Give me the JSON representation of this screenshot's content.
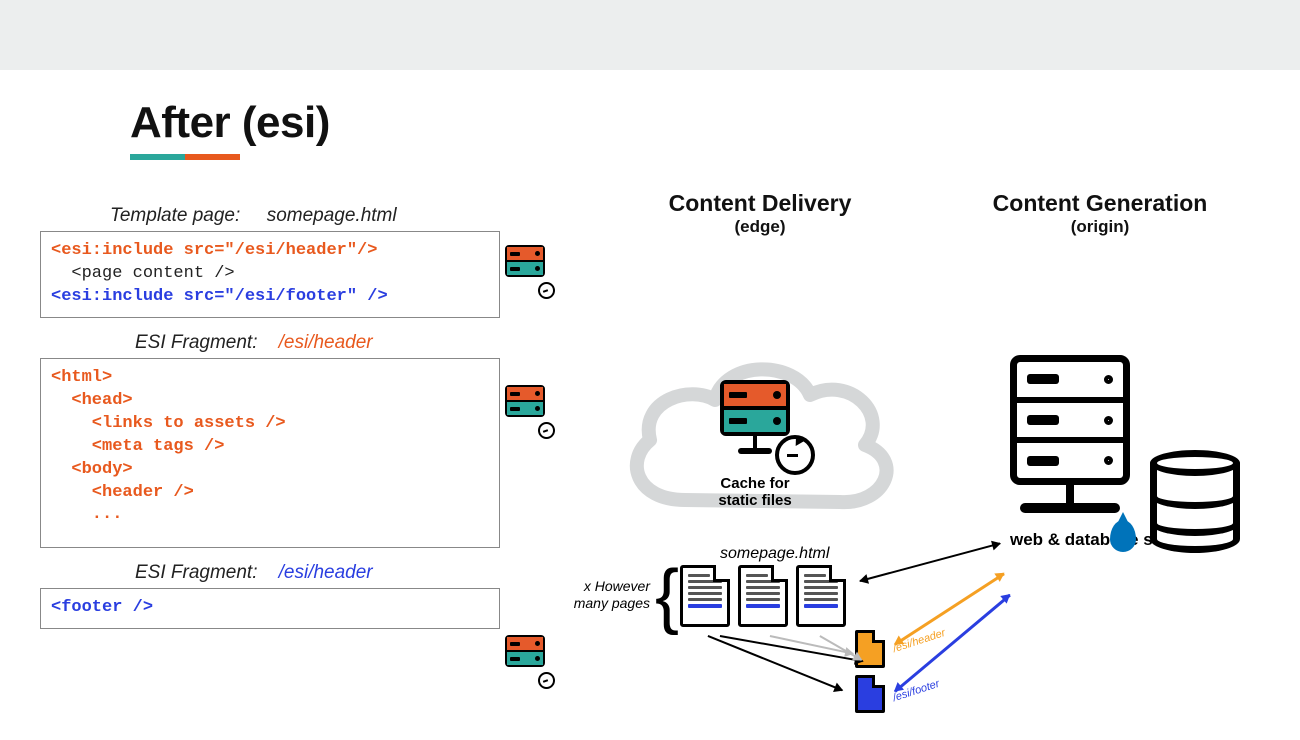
{
  "title": "After (esi)",
  "left": {
    "template": {
      "label_prefix": "Template page:",
      "label_file": "somepage.html",
      "line1": "<esi:include src=\"/esi/header\"/>",
      "line2": "  <page content />",
      "line3": "<esi:include src=\"/esi/footer\" />"
    },
    "frag_header": {
      "label_prefix": "ESI Fragment:",
      "label_path": "/esi/header",
      "code": "<html>\n  <head>\n    <links to assets />\n    <meta tags />\n  <body>\n    <header />\n    ..."
    },
    "frag_footer": {
      "label_prefix": "ESI Fragment:",
      "label_path": "/esi/header",
      "code": "<footer />"
    }
  },
  "columns": {
    "delivery": {
      "title": "Content Delivery",
      "sub": "(edge)"
    },
    "generation": {
      "title": "Content Generation",
      "sub": "(origin)"
    }
  },
  "cloud_caption_line1": "Cache for",
  "cloud_caption_line2": "static files",
  "doc_label": "somepage.html",
  "many_pages": "x However many pages",
  "frag_header_label": "/esi/header",
  "frag_footer_label": "/esi/footer",
  "server_label": "web & database servers"
}
